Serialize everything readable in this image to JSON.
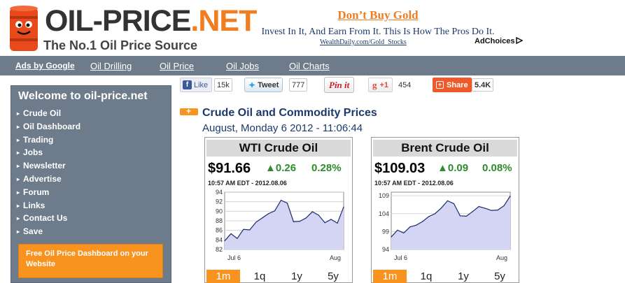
{
  "logo": {
    "title_main": "OIL-PRICE",
    "title_dot": ".",
    "title_net": "NET",
    "tagline": "The No.1 Oil Price Source"
  },
  "ad": {
    "title": "Don’t Buy Gold",
    "body": "Invest In It, And Earn From It. This Is How The Pros Do It.",
    "link": "WealthDaily.com/Gold_Stocks",
    "adchoices": "AdChoices"
  },
  "nav": {
    "items": [
      "Ads by Google",
      "Oil Drilling",
      "Oil Price",
      "Oil Jobs",
      "Oil Charts"
    ]
  },
  "sidebar": {
    "title": "Welcome to oil-price.net",
    "items": [
      "Crude Oil",
      "Oil Dashboard",
      "Trading",
      "Jobs",
      "Newsletter",
      "Advertise",
      "Forum",
      "Links",
      "Contact Us",
      "Save"
    ],
    "promo": "Free Oil Price Dashboard on your Website"
  },
  "social": {
    "like_label": "Like",
    "like_count": "15k",
    "tweet_label": "Tweet",
    "tweet_count": "777",
    "pin_label": "Pin it",
    "gplus_label": "+1",
    "gplus_count": "454",
    "share_label": "Share",
    "share_count": "5.4K"
  },
  "main": {
    "title": "Crude Oil and Commodity Prices",
    "date": "August, Monday 6 2012 - 11:06:44"
  },
  "colors": {
    "accent": "#f7931e",
    "nav": "#6e7b8b",
    "up": "#2e8b2e",
    "link": "#1b3a6b",
    "chart_fill": "#d4d4f5",
    "chart_line": "#1b2a6b"
  },
  "panels": [
    {
      "name": "WTI Crude Oil",
      "price": "$91.66",
      "change": "▲0.26",
      "percent": "0.28%",
      "time": "10:57 AM EDT - 2012.08.06",
      "tabs": [
        "1m",
        "1q",
        "1y",
        "5y"
      ],
      "active_tab": "1m",
      "chart_data": {
        "type": "area",
        "title": "",
        "xlabel": "",
        "ylabel": "",
        "x_ticks": [
          "Jul 6",
          "Aug"
        ],
        "y_ticks": [
          82,
          84,
          86,
          88,
          90,
          92,
          94
        ],
        "ylim": [
          82,
          94
        ],
        "values": [
          83.8,
          85.3,
          84.3,
          86.2,
          86.1,
          87.7,
          88.6,
          89.5,
          90.1,
          92.3,
          91.7,
          87.8,
          87.9,
          88.6,
          89.9,
          89.2,
          87.6,
          88.3,
          87.5,
          90.9
        ],
        "grid": true
      }
    },
    {
      "name": "Brent Crude Oil",
      "price": "$109.03",
      "change": "▲0.09",
      "percent": "0.08%",
      "time": "10:57 AM EDT - 2012.08.06",
      "tabs": [
        "1m",
        "1q",
        "1y",
        "5y"
      ],
      "active_tab": "1m",
      "chart_data": {
        "type": "area",
        "title": "",
        "xlabel": "",
        "ylabel": "",
        "x_ticks": [
          "Jul 6",
          "Aug"
        ],
        "y_ticks": [
          94,
          99,
          104,
          109
        ],
        "ylim": [
          94,
          110
        ],
        "values": [
          97.5,
          99.4,
          98.6,
          100.3,
          100.8,
          101.8,
          103.2,
          104.0,
          105.6,
          107.6,
          106.8,
          103.4,
          103.3,
          104.6,
          106.0,
          105.5,
          104.9,
          105.0,
          106.2,
          108.9
        ],
        "grid": true
      }
    }
  ]
}
